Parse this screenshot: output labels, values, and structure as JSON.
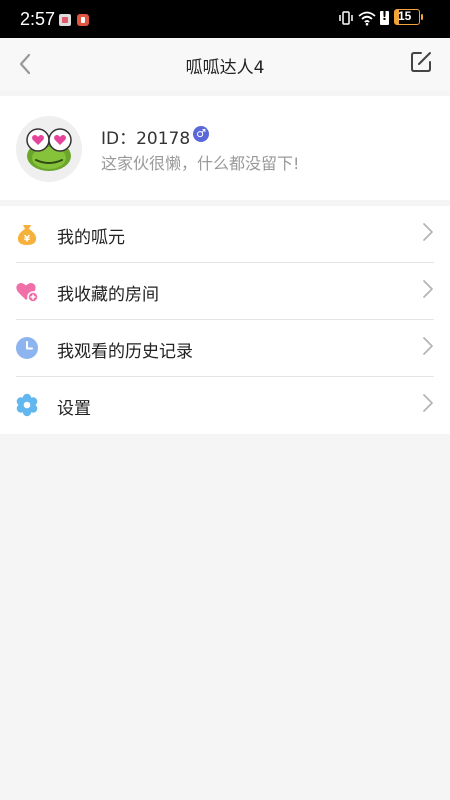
{
  "status_bar": {
    "time": "2:57",
    "battery_level": "15",
    "battery_fraction": 0.15,
    "icons": [
      "app-notification-icon",
      "app-notification-icon",
      "vibrate-icon",
      "wifi-icon",
      "alert-icon",
      "battery-icon"
    ]
  },
  "header": {
    "title": "呱呱达人4",
    "back_icon": "chevron-left-icon",
    "edit_icon": "edit-icon"
  },
  "profile": {
    "avatar": "frog-avatar",
    "id_text": "ID：20178",
    "gender_symbol": "♂",
    "gender_color": "#5a68d8",
    "signature": "这家伙很懒，什么都没留下!"
  },
  "menu": {
    "items": [
      {
        "label": "我的呱元",
        "icon": "money-bag-icon",
        "icon_color": "#f5b13c"
      },
      {
        "label": "我收藏的房间",
        "icon": "heart-plus-icon",
        "icon_color": "#f06fa9"
      },
      {
        "label": "我观看的历史记录",
        "icon": "clock-icon",
        "icon_color": "#8db4ef"
      },
      {
        "label": "设置",
        "icon": "settings-gear-icon",
        "icon_color": "#62b7ee"
      }
    ]
  }
}
